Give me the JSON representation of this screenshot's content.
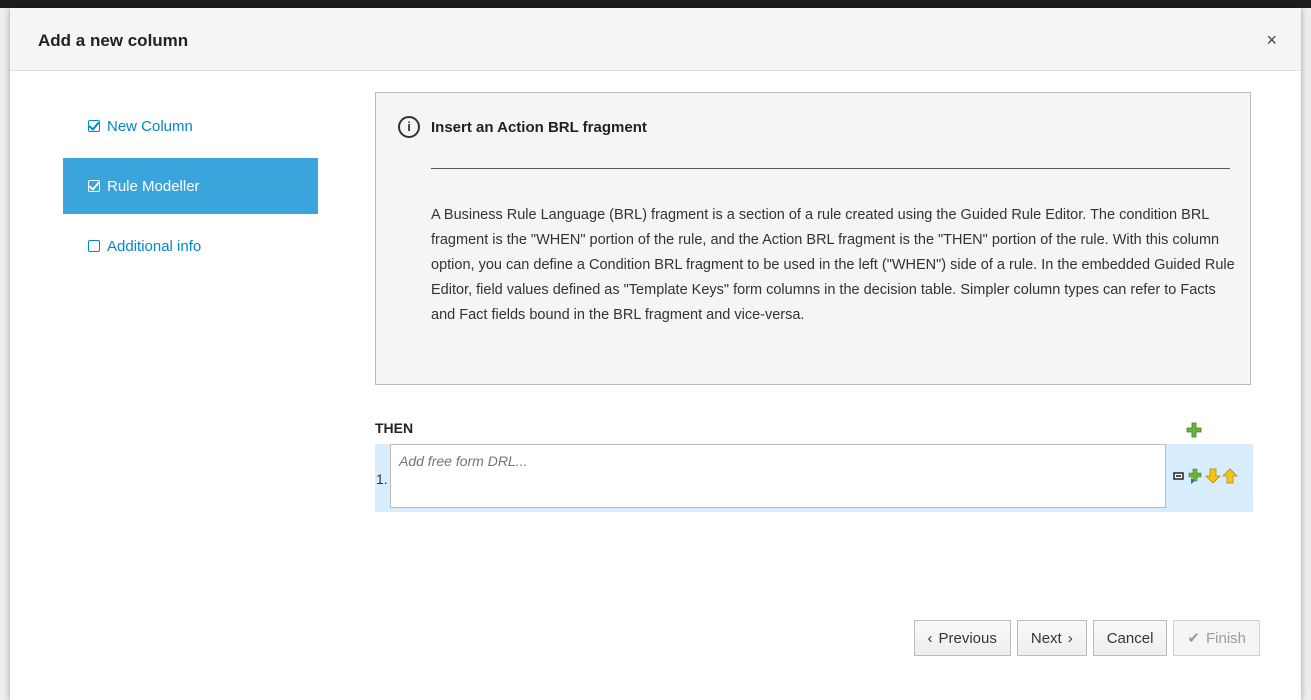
{
  "modal": {
    "title": "Add a new column",
    "close_icon": "close-icon",
    "close_glyph": "×"
  },
  "nav": {
    "items": [
      {
        "label": "New Column",
        "checked": true,
        "active": false
      },
      {
        "label": "Rule Modeller",
        "checked": true,
        "active": true
      },
      {
        "label": "Additional info",
        "checked": false,
        "active": false
      }
    ]
  },
  "info": {
    "icon": "info-icon",
    "icon_glyph": "i",
    "title": "Insert an Action BRL fragment",
    "text": "A Business Rule Language (BRL) fragment is a section of a rule created using the Guided Rule Editor. The condition BRL fragment is the \"WHEN\" portion of the rule, and the Action BRL fragment is the \"THEN\" portion of the rule. With this column option, you can define a Condition BRL fragment to be used in the left (\"WHEN\") side of a rule. In the embedded Guided Rule Editor, field values defined as \"Template Keys\" form columns in the decision table. Simpler column types can refer to Facts and Fact fields bound in the BRL fragment and vice-versa."
  },
  "rule": {
    "then_label": "THEN",
    "rows": [
      {
        "number": "1.",
        "placeholder": "Add free form DRL..."
      }
    ]
  },
  "footer": {
    "previous": "Previous",
    "next": "Next",
    "cancel": "Cancel",
    "finish": "Finish"
  },
  "colors": {
    "accent": "#39a5dc",
    "link": "#0088ce",
    "row_band": "#d8eefe"
  }
}
